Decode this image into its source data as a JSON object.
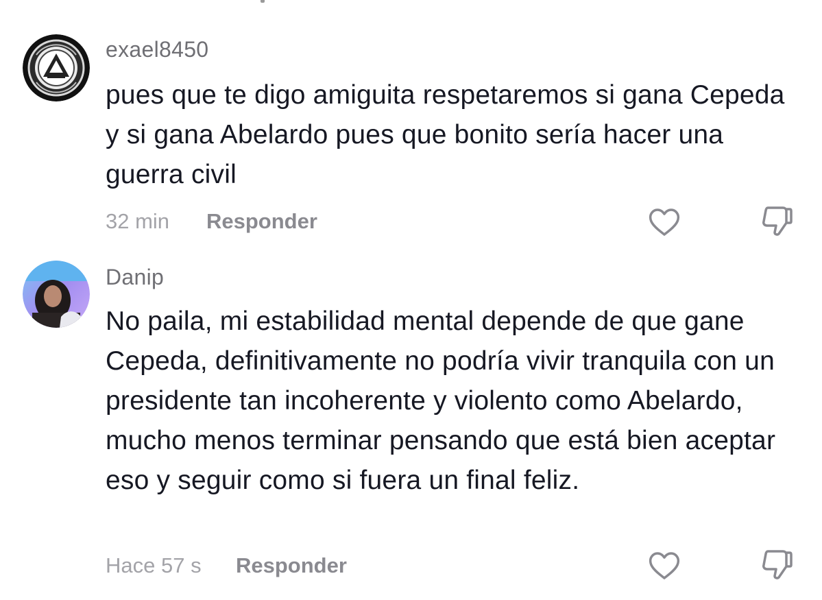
{
  "comments": [
    {
      "username": "exael8450",
      "text": "pues que te digo amiguita respetaremos si gana Cepeda y si gana Abelardo pues que bonito sería hacer una guerra civil",
      "time": "32 min",
      "reply_label": "Responder",
      "avatar_icon": "emblem-avatar",
      "like_icon": "heart-icon",
      "dislike_icon": "thumbs-down-icon"
    },
    {
      "username": "Danip",
      "text": "No paila, mi estabilidad mental depende de que gane Cepeda, definitivamente no podría vivir tranquila con un presidente tan incoherente y violento como Abelardo, mucho menos terminar pensando que está bien aceptar eso y seguir como si fuera un final feliz.",
      "time": "Hace 57 s",
      "reply_label": "Responder",
      "avatar_icon": "photo-avatar",
      "like_icon": "heart-icon",
      "dislike_icon": "thumbs-down-icon"
    }
  ],
  "colors": {
    "text": "#161823",
    "username": "#6f6f74",
    "meta": "#a3a3a8",
    "reply": "#8a8a90",
    "icon": "#8a8a90"
  }
}
